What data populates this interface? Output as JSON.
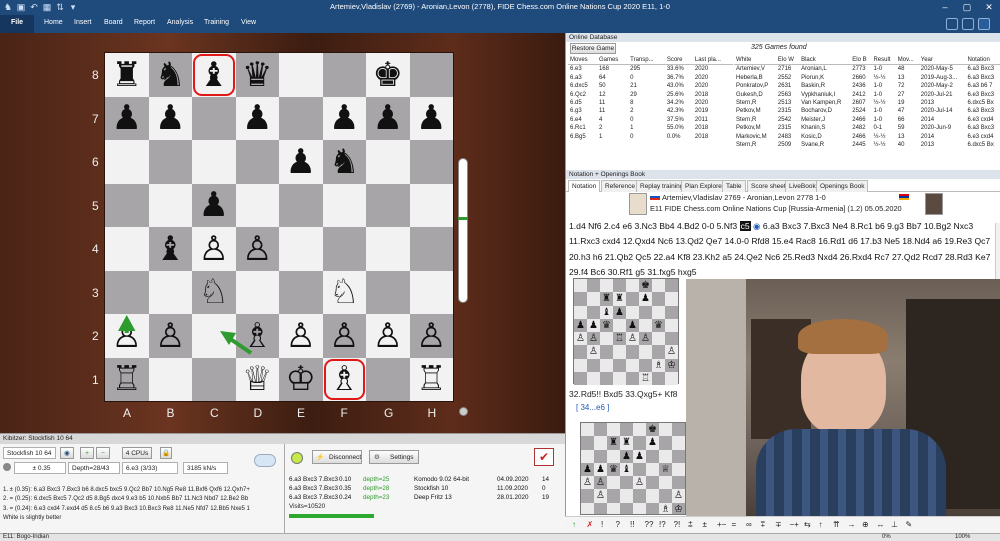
{
  "window": {
    "title": "Artemiev,Vladislav (2769) - Aronian,Levon (2778), FIDE Chess.com Online Nations Cup 2020  E11, 1-0"
  },
  "menu": [
    "File",
    "Home",
    "Insert",
    "Board",
    "Report",
    "Analysis",
    "Training",
    "View"
  ],
  "board": {
    "ranks": [
      "8",
      "7",
      "6",
      "5",
      "4",
      "3",
      "2",
      "1"
    ],
    "files": [
      "A",
      "B",
      "C",
      "D",
      "E",
      "F",
      "G",
      "H"
    ],
    "rows": [
      [
        "♜",
        "♞",
        "♝",
        "♛",
        "",
        "",
        "♚",
        ""
      ],
      [
        "♟",
        "♟",
        "",
        "♟",
        "",
        "♟",
        "♟",
        "♟"
      ],
      [
        "",
        "",
        "",
        "",
        "♟",
        "♞",
        "",
        ""
      ],
      [
        "",
        "",
        "♟",
        "",
        "",
        "",
        "",
        ""
      ],
      [
        "",
        "♝",
        "♙",
        "♙",
        "",
        "",
        "",
        ""
      ],
      [
        "",
        "",
        "♘",
        "",
        "",
        "♘",
        "",
        ""
      ],
      [
        "♙",
        "♙",
        "",
        "♗",
        "♙",
        "♙",
        "♙",
        "♙"
      ],
      [
        "♖",
        "",
        "",
        "♕",
        "♔",
        "♗",
        "",
        "♖"
      ]
    ]
  },
  "kibitzer": {
    "title": "Kibitzer: Stockfish 10 64",
    "engine": "Stockfish 10 64",
    "cpus": "4 CPUs",
    "eval": "± 0.35",
    "depth": "Depth=28/43",
    "move": "6.e3 (3/33)",
    "speed": "3185 kN/s",
    "lines": [
      "1. ± (0.35): 6.a3 Bxc3 7.Bxc3 b6 8.dxc5 bxc5 9.Qc2 Bb7 10.Ng5 Re8 11.Bxf6 Qxf6 12.Qxh7+",
      "2. = (0.25): 6.dxc5 Bxc5 7.Qc2 d5 8.Bg5 dxc4 9.e3 b5 10.Nxb5 Bb7 11.Nc3 Nbd7 12.Be2 Bb",
      "3. = (0.24): 6.e3 cxd4 7.exd4 d5 8.c5 b6 9.a3 Bxc3 10.Bxc3 Re8 11.Ne5 Nfd7 12.Bb5 Nxe5 1"
    ],
    "verdict": "White is slightly better"
  },
  "engines_panel": {
    "disconnect": "Disconnect",
    "settings": "Settings",
    "rows": [
      {
        "line": "6.a3 Bxc3 7.Bxc3",
        "score": "0.10",
        "depth": "depth=25",
        "engine": "Komodo 9.02 64-bit",
        "date": "04.09.2020",
        "n": "14"
      },
      {
        "line": "6.a3 Bxc3 7.Bxc3",
        "score": "0.35",
        "depth": "depth=28",
        "engine": "Stockfish 10",
        "date": "11.09.2020",
        "n": "0"
      },
      {
        "line": "6.a3 Bxc3 7.Bxc3",
        "score": "0.24",
        "depth": "depth=23",
        "engine": "Deep Fritz 13",
        "date": "28.01.2020",
        "n": "19"
      }
    ],
    "visits": "Visits=10520"
  },
  "online_db": {
    "title": "Online Database",
    "restore": "Restore Game",
    "found": "325 Games found",
    "move_headers": [
      "Moves",
      "Games",
      "Transp...",
      "Score",
      "Last pla..."
    ],
    "moves": [
      [
        "6.e3",
        "168",
        "295",
        "33.6%",
        "2020"
      ],
      [
        "6.a3",
        "64",
        "0",
        "36.7%",
        "2020"
      ],
      [
        "6.dxc5",
        "50",
        "21",
        "43.0%",
        "2020"
      ],
      [
        "6.Qc2",
        "12",
        "29",
        "25.6%",
        "2018"
      ],
      [
        "6.d5",
        "11",
        "8",
        "34.2%",
        "2020"
      ],
      [
        "6.g3",
        "11",
        "2",
        "42.3%",
        "2019"
      ],
      [
        "6.e4",
        "4",
        "0",
        "37.5%",
        "2011"
      ],
      [
        "6.Rc1",
        "2",
        "1",
        "55.0%",
        "2018"
      ],
      [
        "6.Bg5",
        "1",
        "0",
        "0.0%",
        "2018"
      ]
    ],
    "game_headers": [
      "White",
      "Elo W",
      "Black",
      "Elo B",
      "Result",
      "Mov...",
      "Year",
      "Notation"
    ],
    "games": [
      [
        "Artemiev,V",
        "2716",
        "Aronian,L",
        "2773",
        "1-0",
        "48",
        "2020-May-5",
        "6.a3 Bxc3"
      ],
      [
        "Heberla,B",
        "2552",
        "Piorun,K",
        "2660",
        "½-½",
        "13",
        "2019-Aug-3...",
        "6.a3 Bxc3"
      ],
      [
        "Ponkratov,P",
        "2631",
        "Baskin,R",
        "2436",
        "1-0",
        "72",
        "2020-May-2",
        "6.a3 b6 7"
      ],
      [
        "Gukesh,D",
        "2563",
        "Vypkhaniuk,I",
        "2412",
        "1-0",
        "27",
        "2020-Jul-21",
        "6.e3 Bxc3"
      ],
      [
        "Stern,R",
        "2513",
        "Van Kampen,R",
        "2607",
        "½-½",
        "19",
        "2013",
        "6.dxc5 Bx"
      ],
      [
        "Petkov,M",
        "2315",
        "Bocharov,D",
        "2524",
        "1-0",
        "47",
        "2020-Jul-14",
        "6.a3 Bxc3"
      ],
      [
        "Stern,R",
        "2542",
        "Meister,J",
        "2466",
        "1-0",
        "66",
        "2014",
        "6.e3 cxd4"
      ],
      [
        "Petkov,M",
        "2315",
        "Khanin,S",
        "2482",
        "0-1",
        "59",
        "2020-Jun-9",
        "6.a3 Bxc3"
      ],
      [
        "Markovic,M",
        "2483",
        "Kosic,D",
        "2466",
        "½-½",
        "13",
        "2014",
        "6.e3 cxd4"
      ],
      [
        "Stern,R",
        "2509",
        "Svane,R",
        "2445",
        "½-½",
        "40",
        "2013",
        "6.dxc5 Bx"
      ]
    ]
  },
  "notation": {
    "panel_title": "Notation + Openings Book",
    "tabs": [
      "Notation",
      "Reference",
      "Replay training",
      "Plan Explorer",
      "Table",
      "Score sheet",
      "LiveBook",
      "Openings Book"
    ],
    "header_line": "Artemiev,Vladislav 2769 - Aronian,Levon 2778  1-0",
    "event_line": "E11 FIDE Chess.com Online Nations Cup [Russia-Armenia] (1.2) 05.05.2020",
    "moves_before": "1.d4  Nf6  2.c4  e6  3.Nc3  Bb4  4.Bd2  0-0  5.Nf3",
    "current_move": "c5",
    "moves_after": "6.a3  Bxc3  7.Bxc3  Ne4  8.Rc1  b6  9.g3  Bb7  10.Bg2 Nxc3  11.Rxc3  cxd4  12.Qxd4  Nc6  13.Qd2  Qe7  14.0-0  Rfd8  15.e4  Rac8  16.Rd1  d6  17.b3  Ne5  18.Nd4  a6  19.Re3  Qc7  20.h3  h6  21.Qb2  Qc5  22.a4  Kf8  23.Kh2  a5  24.Qe2  Nc6  25.Red3  Nxd4  26.Rxd4  Rc7  27.Qd2 Rcd7  28.Rd3  Ke7  29.f4  Bc6  30.Rf1  g5  31.fxg5  hxg5",
    "variation": "32.Rd5!!  Bxd5  33.Qxg5+  Kf8",
    "variation_sub": "[ 34...e6 ]"
  },
  "symbols": [
    "↑",
    "✗",
    "!",
    "?",
    "!!",
    "??",
    "!?",
    "?!",
    "⩲",
    "±",
    "+−",
    "=",
    "∞",
    "⩱",
    "∓",
    "−+",
    "⇆",
    "↑",
    "⇈",
    "→",
    "⊕",
    "↔",
    "⊥",
    "✎"
  ],
  "status_bar": {
    "opening": "E11: Bogo-Indian",
    "progress": "0%",
    "zoom": "100%"
  },
  "colors": {
    "titlebar": "#1f4a7c",
    "highlight": "#e01818",
    "arrow": "#2e9b2e",
    "light_square": "#f2f2f2",
    "dark_square": "#a8a5a8"
  }
}
